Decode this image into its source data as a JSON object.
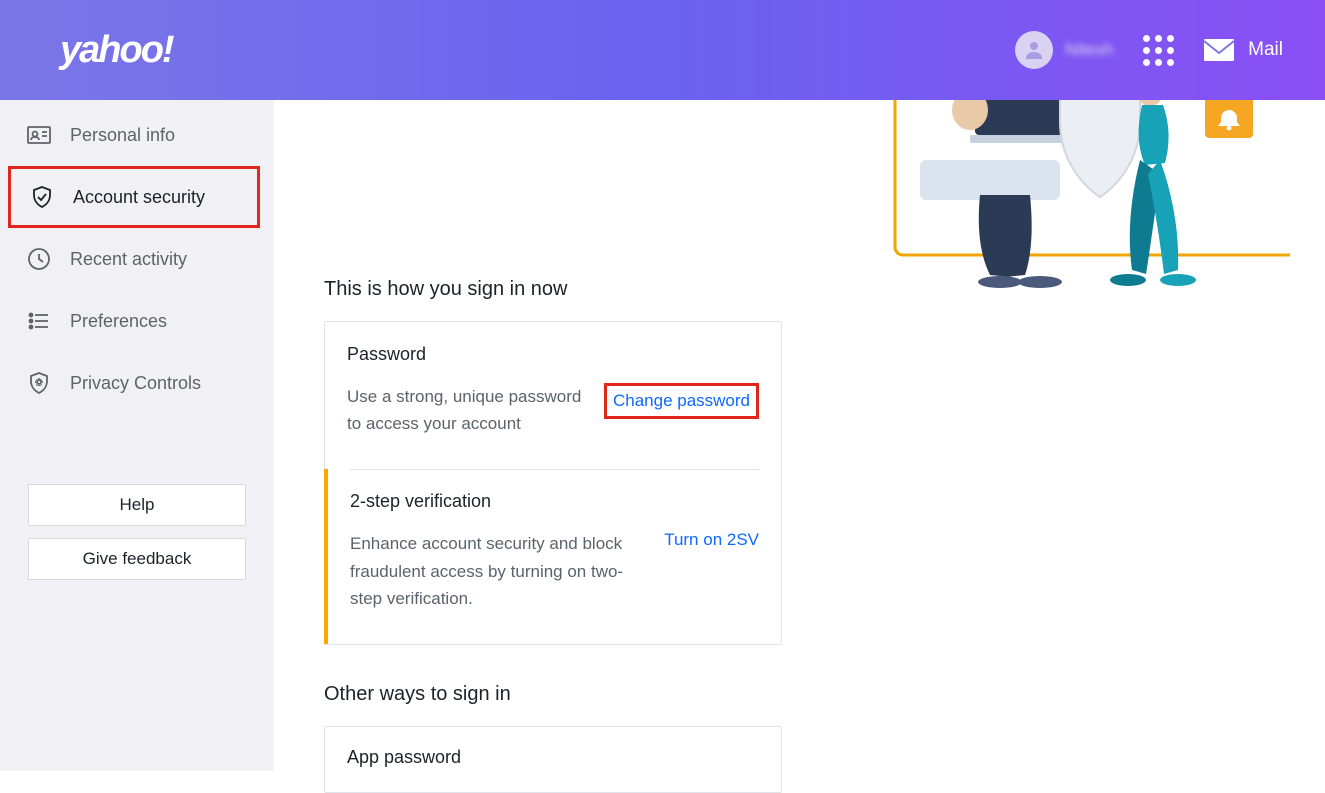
{
  "header": {
    "logo": "yahoo!",
    "username": "Nitesh",
    "mail_label": "Mail"
  },
  "sidebar": {
    "items": [
      {
        "label": "Personal info"
      },
      {
        "label": "Account security"
      },
      {
        "label": "Recent activity"
      },
      {
        "label": "Preferences"
      },
      {
        "label": "Privacy Controls"
      }
    ],
    "help_label": "Help",
    "feedback_label": "Give feedback"
  },
  "content": {
    "signin_heading": "This is how you sign in now",
    "password": {
      "title": "Password",
      "description": "Use a strong, unique password to access your account",
      "action": "Change password"
    },
    "twostep": {
      "title": "2-step verification",
      "description": "Enhance account security and block fraudulent access by turning on two-step verification.",
      "action": "Turn on 2SV"
    },
    "other_heading": "Other ways to sign in",
    "app_password": {
      "title": "App password"
    }
  }
}
